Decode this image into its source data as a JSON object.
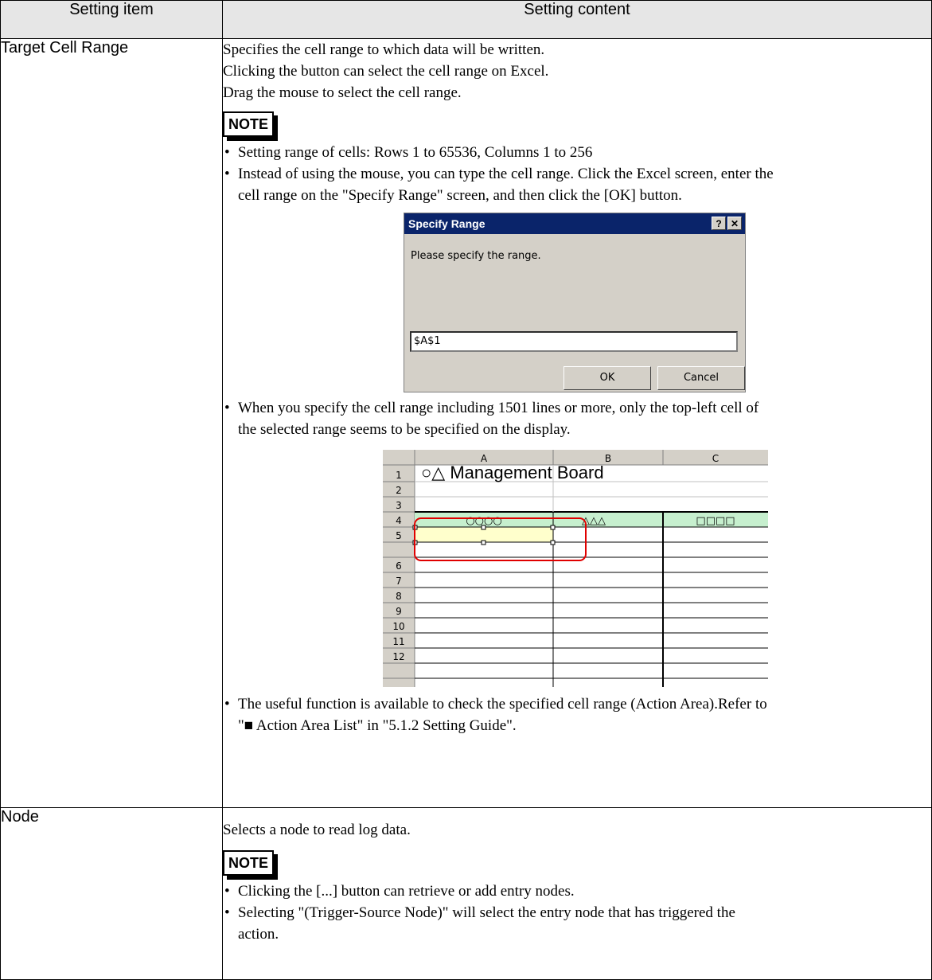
{
  "header": {
    "col1": "Setting item",
    "col2": "Setting content"
  },
  "row1": {
    "item": "Target Cell Range",
    "intro": [
      "Specifies the cell range to which data will be written.",
      "Clicking the button can select the cell range on Excel.",
      "Drag the mouse to select the cell range."
    ],
    "note_label": "NOTE",
    "bullet1": "Setting range of cells: Rows 1 to 65536, Columns 1 to 256",
    "bullet2_line1": "Instead of using the mouse, you can type the cell range. Click the Excel screen, enter the",
    "bullet2_line2": "cell range on the \"Specify Range\" screen, and then click the [OK] button.",
    "dialog": {
      "title": "Specify Range",
      "help_btn": "?",
      "close_btn": "✕",
      "prompt": "Please specify the range.",
      "input_value": "$A$1",
      "ok": "OK",
      "cancel": "Cancel"
    },
    "bullet3_line1": "When you specify the cell range including 1501 lines or more, only the top-left cell of",
    "bullet3_line2": "the selected range seems to be specified on the display.",
    "sheet": {
      "columns": [
        "A",
        "B",
        "C"
      ],
      "rows": [
        "1",
        "2",
        "3",
        "4",
        "5",
        "6",
        "7",
        "8",
        "9",
        "10",
        "11",
        "12"
      ],
      "title": "○△ Management Board",
      "header_cells": [
        "○○○○",
        "△△△",
        "□□□□"
      ]
    },
    "bullet4_line1": "The useful function is available to check the specified cell range (Action Area).Refer to",
    "bullet4_line2": "\"■ Action Area List\" in \"5.1.2 Setting Guide\"."
  },
  "row2": {
    "item": "Node",
    "intro": "Selects a node to read log data.",
    "note_label": "NOTE",
    "bullet1": "Clicking the [...] button can retrieve or add entry nodes.",
    "bullet2_line1": "Selecting \"(Trigger-Source Node)\" will select the entry node that has triggered the",
    "bullet2_line2": "action."
  },
  "colors": {
    "header_bg": "#e6e6e6",
    "dialog_title_bg": "#0a246a",
    "dialog_bg": "#d4d0c8",
    "sheet_header_row": "#c6efce",
    "selection_outline": "#e00000"
  }
}
